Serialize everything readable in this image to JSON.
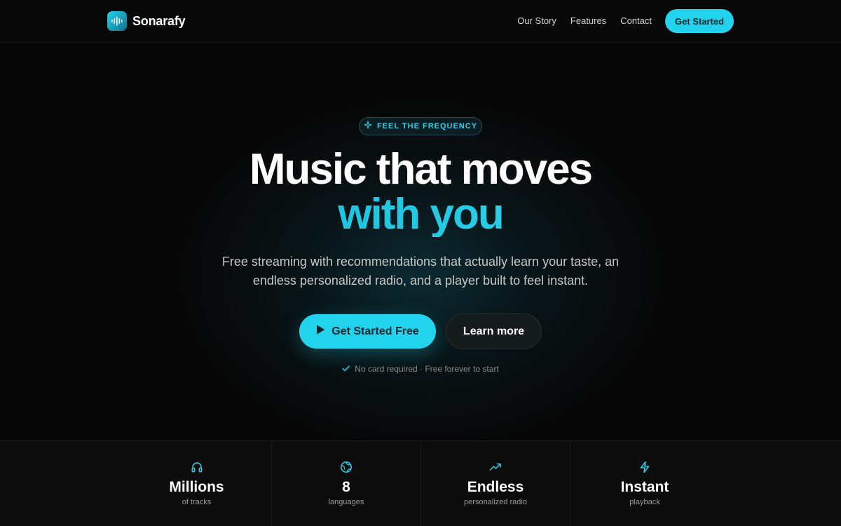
{
  "brand": {
    "name": "Sonarafy",
    "logo_icon": "sound-wave-icon",
    "accent": "#22d3ee"
  },
  "nav": {
    "links": [
      "Our Story",
      "Features",
      "Contact"
    ],
    "cta": "Get Started"
  },
  "hero": {
    "badge": {
      "icon": "sparkle-icon",
      "text": "FEEL THE FREQUENCY"
    },
    "headline_line1": "Music that moves",
    "headline_line2": "with you",
    "subtitle_line1": "Free streaming with recommendations that actually learn your taste, an",
    "subtitle_line2": "endless personalized radio, and a player built to feel instant.",
    "primary_button": {
      "icon": "play-icon",
      "label": "Get Started Free"
    },
    "secondary_button": {
      "label": "Learn more"
    },
    "note": {
      "icon": "check-icon",
      "text": "No card required · Free forever to start"
    }
  },
  "stats": [
    {
      "icon": "headphones-icon",
      "value": "Millions",
      "label": "of tracks"
    },
    {
      "icon": "globe-icon",
      "value": "8",
      "label": "languages"
    },
    {
      "icon": "trending-up-icon",
      "value": "Endless",
      "label": "personalized radio"
    },
    {
      "icon": "lightning-icon",
      "value": "Instant",
      "label": "playback"
    }
  ]
}
